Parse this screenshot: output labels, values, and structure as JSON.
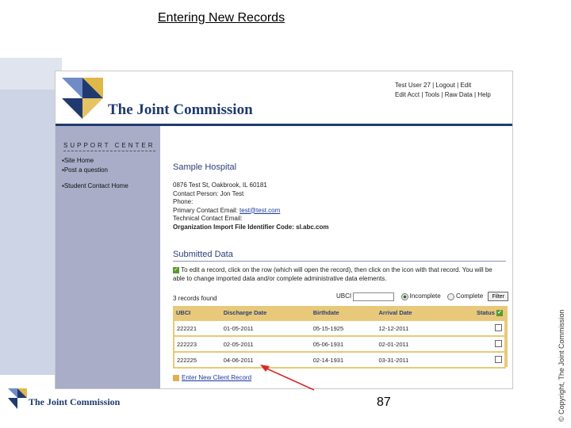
{
  "slide": {
    "title": "Entering New Records",
    "copyright": "© Copyright, The Joint Commission",
    "page_number": "87",
    "footer_brand": "The Joint Commission"
  },
  "header": {
    "brand": "The Joint Commission",
    "user_line1": "Test User 27 | Logout | Edit",
    "user_line2": "Edit Acct | Tools | Raw Data | Help"
  },
  "sidebar": {
    "heading": "SUPPORT CENTER",
    "items": [
      "Site Home",
      "Post a question",
      "Student Contact Home"
    ]
  },
  "hospital": {
    "name": "Sample Hospital",
    "address": "0876 Test St, Oakbrook, IL 60181",
    "contact": "Contact Person: Jon Test",
    "phone": "Phone:",
    "primary_email_label": "Primary Contact Email:",
    "primary_email": "test@test.com",
    "tech_email": "Technical Contact Email:",
    "org_code": "Organization Import File Identifier Code: sl.abc.com"
  },
  "submitted": {
    "heading": "Submitted Data",
    "instructions": "To edit a record, click on the row (which will open the record), then click on the icon with that record. You will be able to change imported data and/or complete administrative data elements.",
    "found": "3 records found",
    "ubci_label": "UBCI",
    "radio_incomplete": "Incomplete",
    "radio_complete": "Complete",
    "filter_button": "Filter"
  },
  "table": {
    "headers": [
      "UBCI",
      "Discharge Date",
      "Birthdate",
      "Arrival Date",
      "Status"
    ],
    "rows": [
      [
        "222221",
        "01-05-2011",
        "05-15-1925",
        "12-12-2011"
      ],
      [
        "222223",
        "02-05-2011",
        "05-06-1931",
        "02-01-2011"
      ],
      [
        "222225",
        "04-06-2011",
        "02-14-1931",
        "03-31-2011"
      ]
    ]
  },
  "links": {
    "enter_new": "Enter New Client Record"
  },
  "colors": {
    "brand_navy": "#1f3a6e",
    "table_header": "#e8c97a",
    "sidebar": "#a9adc8",
    "arrow": "#d42a2a"
  }
}
